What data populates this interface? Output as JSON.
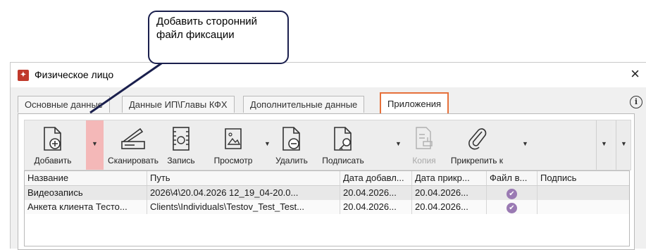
{
  "window": {
    "title": "Физическое лицо",
    "close_symbol": "×"
  },
  "tabs": [
    {
      "label": "Основные данные",
      "active": false
    },
    {
      "label": "Данные ИП\\Главы КФХ",
      "active": false
    },
    {
      "label": "Дополнительные данные",
      "active": false
    },
    {
      "label": "Приложения",
      "active": true
    }
  ],
  "info_symbol": "i",
  "toolbar": {
    "add": "Добавить",
    "scan": "Сканировать",
    "record": "Запись",
    "view": "Просмотр",
    "delete": "Удалить",
    "sign": "Подписать",
    "copy": "Копия",
    "attach": "Прикрепить к"
  },
  "table": {
    "columns": [
      "Название",
      "Путь",
      "Дата добавл...",
      "Дата прикр...",
      "Файл в...",
      "Подпись"
    ],
    "rows": [
      [
        "Видеозапись",
        "2026\\4\\20.04.2026 12_19_04-20.0...",
        "20.04.2026...",
        "20.04.2026...",
        "check",
        ""
      ],
      [
        "Анкета клиента Тесто...",
        "Clients\\Individuals\\Testov_Test_Test...",
        "20.04.2026...",
        "20.04.2026...",
        "check",
        ""
      ]
    ]
  },
  "callout": {
    "text": "Добавить сторонний файл фиксации",
    "border_color": "#1a1f4d"
  },
  "colors": {
    "active_tab_border": "#e6703a",
    "highlight": "#f4b8b8",
    "check": "#9a7ab3"
  }
}
